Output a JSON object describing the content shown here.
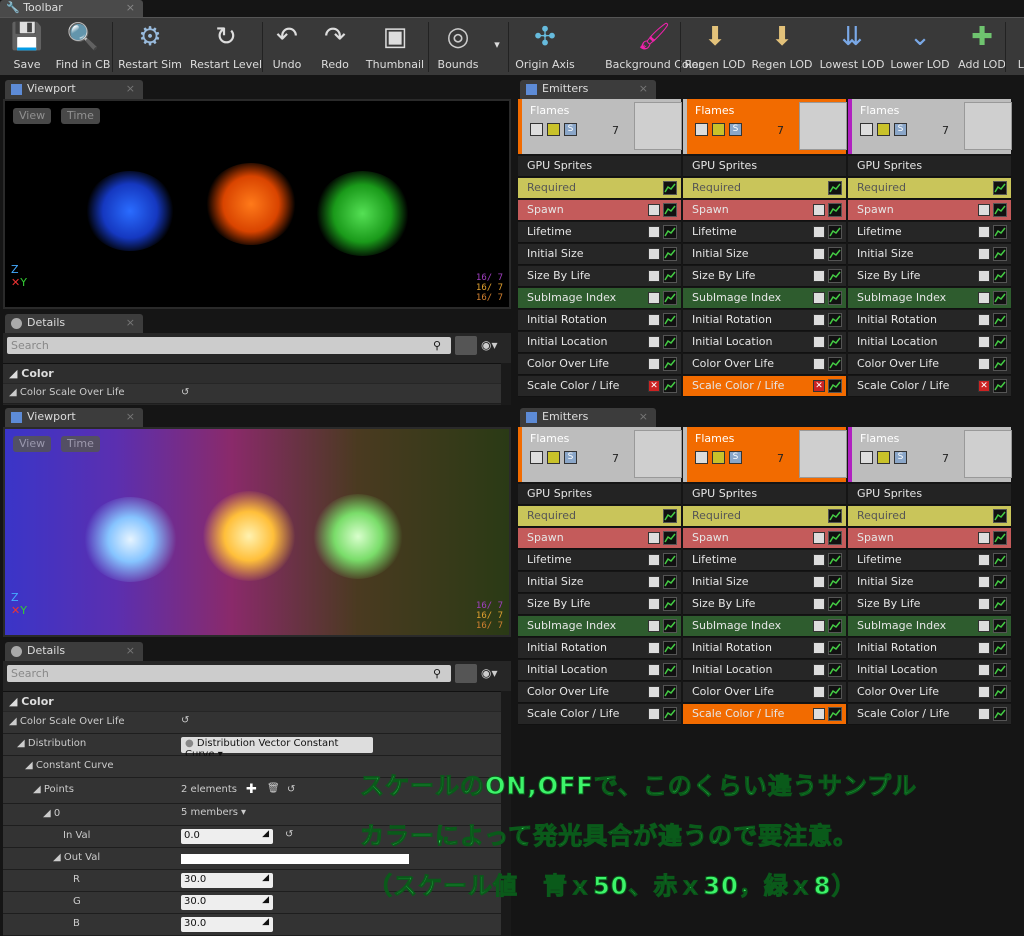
{
  "toolbar": {
    "tab_title": "Toolbar",
    "buttons": [
      {
        "label": "Save",
        "icon": "save-icon"
      },
      {
        "label": "Find in CB",
        "icon": "magnifier-icon"
      },
      {
        "label": "Restart Sim",
        "icon": "gear-icon"
      },
      {
        "label": "Restart Level",
        "icon": "refresh-icon"
      },
      {
        "label": "Undo",
        "icon": "undo-icon"
      },
      {
        "label": "Redo",
        "icon": "redo-icon"
      },
      {
        "label": "Thumbnail",
        "icon": "thumbnail-icon"
      },
      {
        "label": "Bounds",
        "icon": "bounds-icon"
      },
      {
        "label": "Origin Axis",
        "icon": "axis-icon"
      },
      {
        "label": "Background Color",
        "icon": "paint-icon"
      },
      {
        "label": "Regen LOD",
        "icon": "regen-lod-icon"
      },
      {
        "label": "Regen LOD",
        "icon": "regen-lod-icon"
      },
      {
        "label": "Lowest LOD",
        "icon": "lowest-lod-icon"
      },
      {
        "label": "Lower LOD",
        "icon": "lower-lod-icon"
      },
      {
        "label": "Add LOD",
        "icon": "add-lod-icon"
      },
      {
        "label": "LO",
        "icon": ""
      }
    ]
  },
  "viewport": {
    "tab_title": "Viewport",
    "view_btn": "View",
    "time_btn": "Time",
    "stats": [
      "16/ 7",
      "16/ 7",
      "16/ 7"
    ],
    "stat_colors": [
      "#a040c0",
      "#e0a030",
      "#d08030"
    ]
  },
  "details": {
    "tab_title": "Details",
    "search_placeholder": "Search",
    "category": "Color",
    "property": "Color Scale Over Life",
    "distribution_label": "Distribution",
    "distribution_value": "Distribution Vector Constant Curve",
    "constant_curve": "Constant Curve",
    "points_label": "Points",
    "points_value": "2 elements",
    "index0": "0",
    "members": "5 members",
    "in_val_label": "In Val",
    "in_val": "0.0",
    "out_val_label": "Out Val",
    "r_label": "R",
    "r_val": "30.0",
    "g_label": "G",
    "g_val": "30.0",
    "b_label": "B",
    "b_val": "30.0"
  },
  "emitters": {
    "tab_title": "Emitters",
    "columns": [
      {
        "name": "Flames",
        "count": "7"
      },
      {
        "name": "Flames",
        "count": "7"
      },
      {
        "name": "Flames",
        "count": "7"
      }
    ],
    "rows": [
      "GPU Sprites",
      "Required",
      "Spawn",
      "Lifetime",
      "Initial Size",
      "Size By Life",
      "SubImage Index",
      "Initial Rotation",
      "Initial Location",
      "Color Over Life",
      "Scale Color / Life"
    ]
  },
  "annotation": {
    "line1": "スケールのON,OFFで、このくらい違うサンプル",
    "line2": "カラーによって発光具合が違うので要注意。",
    "line3": "（スケール値　青ｘ50、赤ｘ30，緑ｘ8）"
  }
}
